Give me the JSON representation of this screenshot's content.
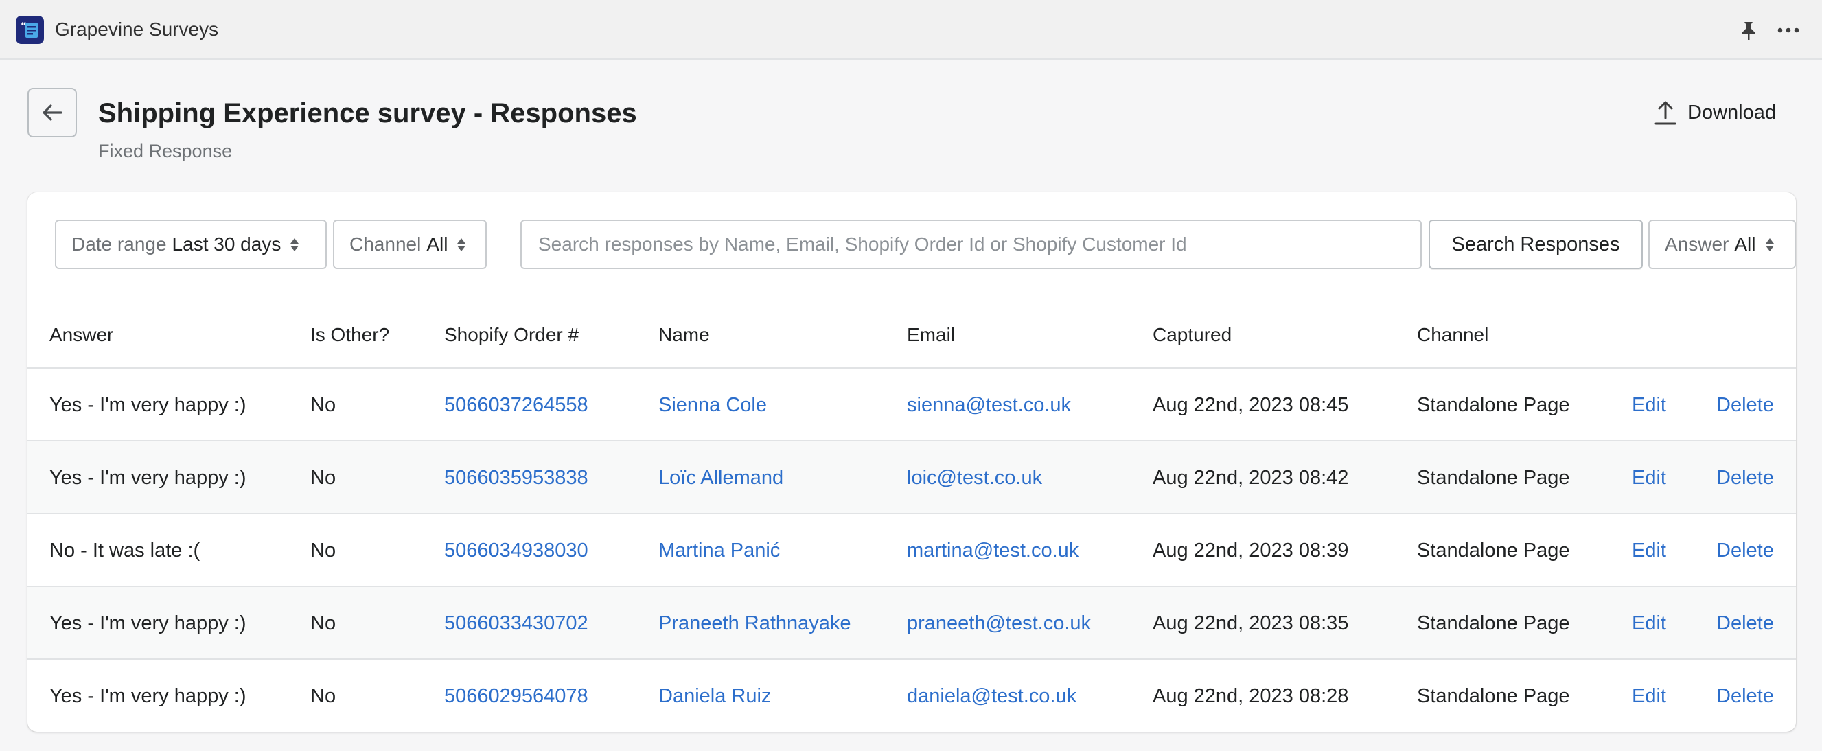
{
  "app": {
    "title": "Grapevine Surveys",
    "icons": [
      "app-logo",
      "pin-icon",
      "more-icon"
    ]
  },
  "header": {
    "title": "Shipping Experience survey - Responses",
    "subtitle": "Fixed Response",
    "download_label": "Download"
  },
  "filters": {
    "date_range": {
      "label": "Date range",
      "value": "Last 30 days"
    },
    "channel": {
      "label": "Channel",
      "value": "All"
    },
    "search": {
      "placeholder": "Search responses by Name, Email, Shopify Order Id or Shopify Customer Id",
      "value": ""
    },
    "search_button": "Search Responses",
    "answer": {
      "label": "Answer",
      "value": "All"
    }
  },
  "table": {
    "headers": [
      "Answer",
      "Is Other?",
      "Shopify Order #",
      "Name",
      "Email",
      "Captured",
      "Channel"
    ],
    "rows": [
      {
        "answer": "Yes - I'm very happy :)",
        "is_other": "No",
        "order": "5066037264558",
        "name": "Sienna Cole",
        "email": "sienna@test.co.uk",
        "captured": "Aug 22nd, 2023 08:45",
        "channel": "Standalone Page",
        "edit": "Edit",
        "delete": "Delete"
      },
      {
        "answer": "Yes - I'm very happy :)",
        "is_other": "No",
        "order": "5066035953838",
        "name": "Loïc Allemand",
        "email": "loic@test.co.uk",
        "captured": "Aug 22nd, 2023 08:42",
        "channel": "Standalone Page",
        "edit": "Edit",
        "delete": "Delete"
      },
      {
        "answer": "No - It was late :(",
        "is_other": "No",
        "order": "5066034938030",
        "name": "Martina Panić",
        "email": "martina@test.co.uk",
        "captured": "Aug 22nd, 2023 08:39",
        "channel": "Standalone Page",
        "edit": "Edit",
        "delete": "Delete"
      },
      {
        "answer": "Yes - I'm very happy :)",
        "is_other": "No",
        "order": "5066033430702",
        "name": "Praneeth Rathnayake",
        "email": "praneeth@test.co.uk",
        "captured": "Aug 22nd, 2023 08:35",
        "channel": "Standalone Page",
        "edit": "Edit",
        "delete": "Delete"
      },
      {
        "answer": "Yes - I'm very happy :)",
        "is_other": "No",
        "order": "5066029564078",
        "name": "Daniela Ruiz",
        "email": "daniela@test.co.uk",
        "captured": "Aug 22nd, 2023 08:28",
        "channel": "Standalone Page",
        "edit": "Edit",
        "delete": "Delete"
      }
    ]
  },
  "colors": {
    "link": "#2c6ecb",
    "alt_row": "#f8f9f9",
    "app_logo": "#1f2a7a"
  }
}
